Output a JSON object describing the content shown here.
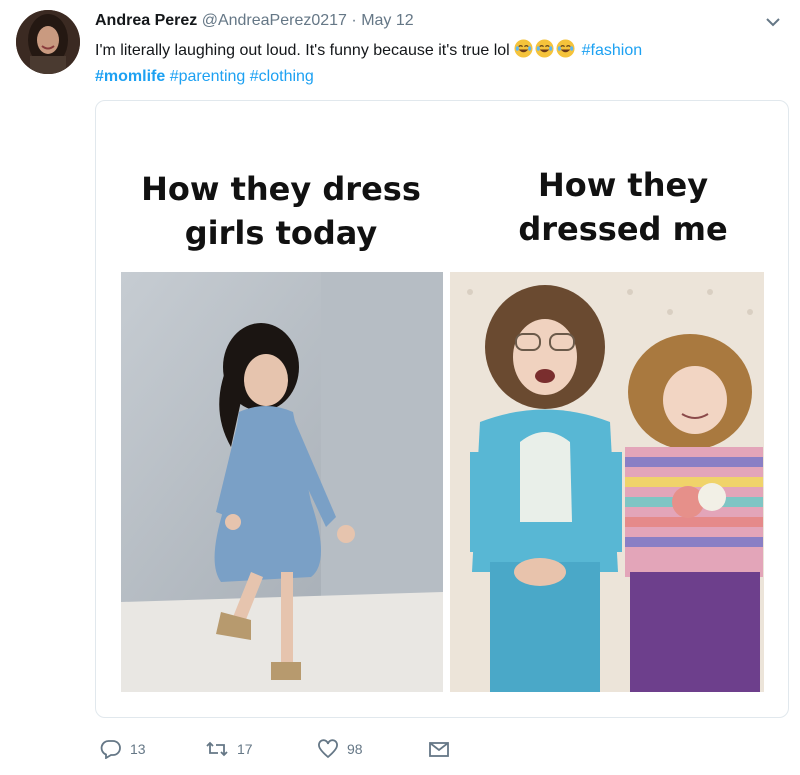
{
  "tweet": {
    "display_name": "Andrea Perez",
    "handle": "@AndreaPerez0217",
    "separator": "·",
    "date": "May 12",
    "text": "I'm literally laughing out loud. It's funny because it's true lol",
    "emoji": [
      "face-with-tears-of-joy",
      "face-with-tears-of-joy",
      "face-with-tears-of-joy"
    ],
    "hashtags": [
      "#fashion",
      "#momlife",
      "#parenting",
      "#clothing"
    ],
    "highlighted_hashtag": "#momlife"
  },
  "media": {
    "left_caption": "How they dress girls today",
    "right_caption": "How they dressed me"
  },
  "actions": {
    "reply_count": "13",
    "retweet_count": "17",
    "like_count": "98"
  },
  "colors": {
    "link": "#1da1f2",
    "meta": "#657786",
    "border": "#e1e8ed"
  },
  "icons": [
    "avatar",
    "chevron-down-icon",
    "reply-icon",
    "retweet-icon",
    "like-icon",
    "message-icon"
  ]
}
